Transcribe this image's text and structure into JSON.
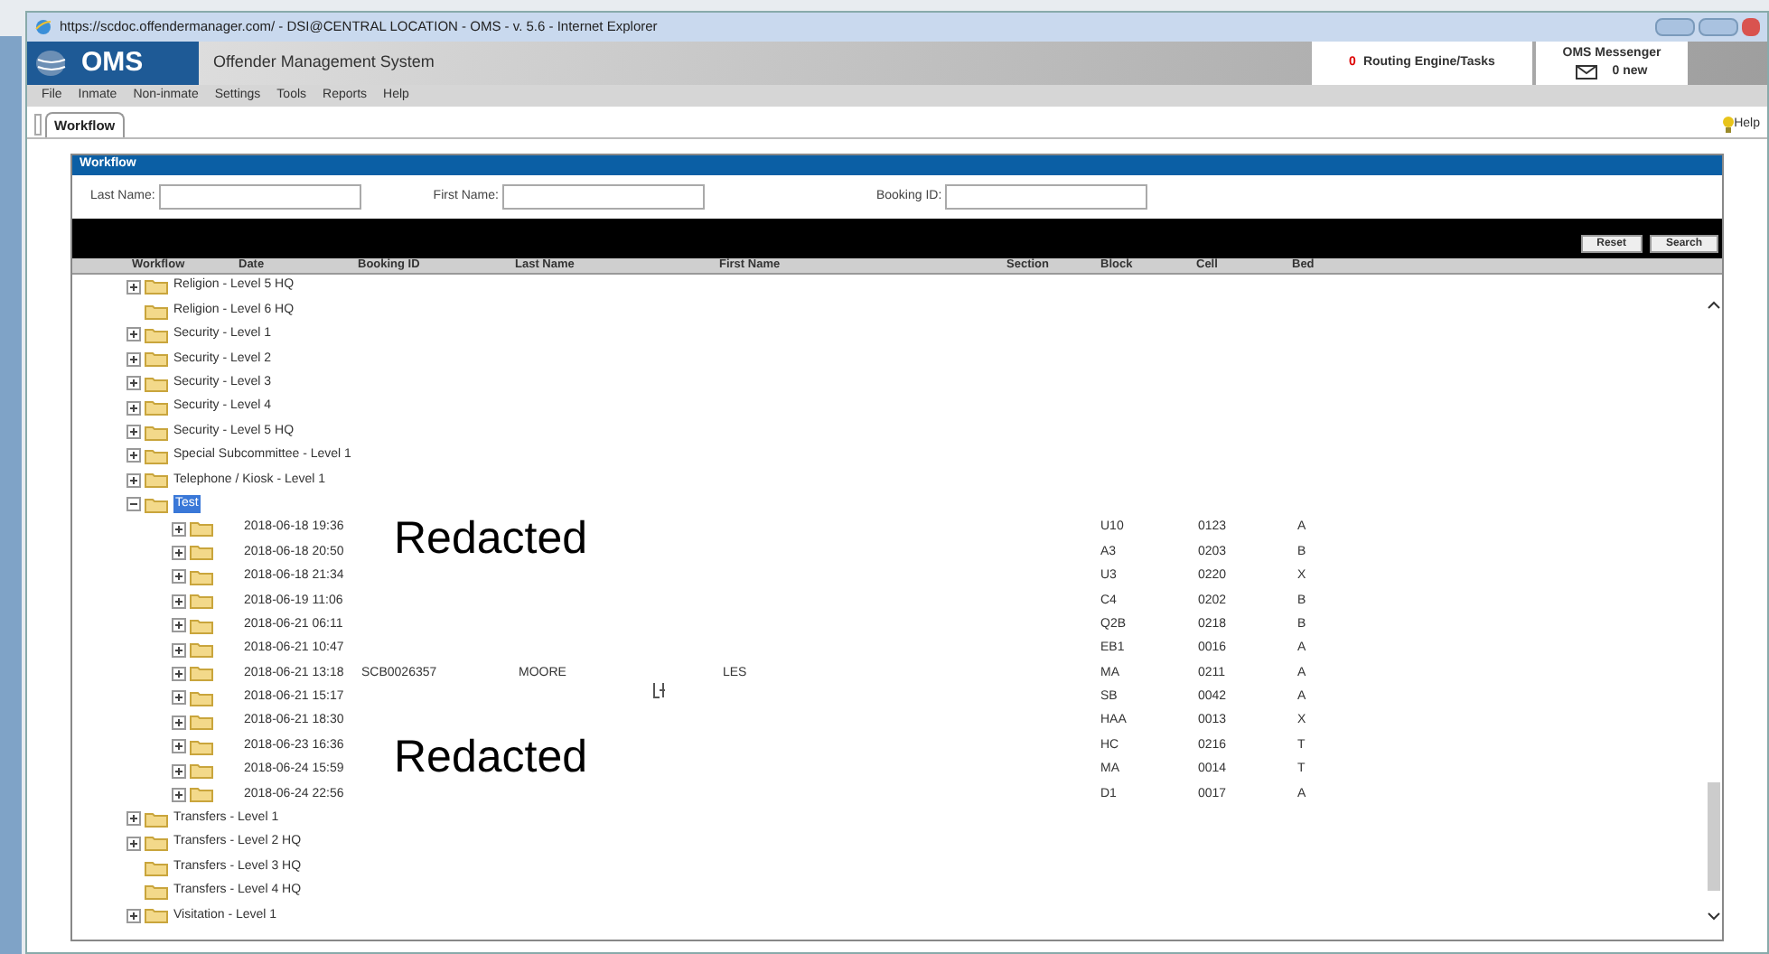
{
  "window": {
    "title": "https://scdoc.offendermanager.com/ - DSI@CENTRAL LOCATION - OMS - v. 5.6 - Internet Explorer"
  },
  "header": {
    "logo_text": "OMS",
    "app_name": "Offender Management System",
    "routing": {
      "count": "0",
      "label": "Routing Engine/Tasks"
    },
    "messenger": {
      "title": "OMS Messenger",
      "count": "0 new"
    }
  },
  "menu": [
    "File",
    "Inmate",
    "Non-inmate",
    "Settings",
    "Tools",
    "Reports",
    "Help"
  ],
  "tabs": [
    {
      "label": "Workflow",
      "selected": true
    }
  ],
  "help": "Help",
  "panel": {
    "title": "Workflow",
    "fields": [
      {
        "label": "Last Name:"
      },
      {
        "label": "First Name:"
      },
      {
        "label": "Booking ID:"
      }
    ],
    "buttons": [
      "Reset",
      "Search"
    ]
  },
  "table": {
    "columns": [
      "Workflow",
      "Date",
      "Booking ID",
      "Last Name",
      "First Name",
      "Section",
      "Block",
      "Cell",
      "Bed"
    ],
    "rows": [
      {
        "label": "Religion - Level 5 HQ",
        "expandable": true,
        "expanded": false,
        "selected": false
      },
      {
        "label": "Religion - Level 6 HQ",
        "expandable": false,
        "selected": false
      },
      {
        "label": "Security - Level 1",
        "expandable": true,
        "expanded": false,
        "selected": false
      },
      {
        "label": "Security - Level 2",
        "expandable": true,
        "expanded": false,
        "selected": false
      },
      {
        "label": "Security - Level 3",
        "expandable": true,
        "expanded": false,
        "selected": false
      },
      {
        "label": "Security - Level 4",
        "expandable": true,
        "expanded": false,
        "selected": false
      },
      {
        "label": "Security - Level 5 HQ",
        "expandable": true,
        "expanded": false,
        "selected": false
      },
      {
        "label": "Special Subcommittee - Level 1",
        "expandable": true,
        "expanded": false,
        "selected": false
      },
      {
        "label": "Telephone / Kiosk - Level 1",
        "expandable": true,
        "expanded": false,
        "selected": false
      },
      {
        "label": "Test",
        "expandable": true,
        "expanded": true,
        "selected": true,
        "children": [
          {
            "date": "2018-06-18 19:36",
            "block": "U10",
            "cell": "0123",
            "bed": "A"
          },
          {
            "date": "2018-06-18 20:50",
            "block": "A3",
            "cell": "0203",
            "bed": "B"
          },
          {
            "date": "2018-06-18 21:34",
            "block": "U3",
            "cell": "0220",
            "bed": "X"
          },
          {
            "date": "2018-06-19 11:06",
            "block": "C4",
            "cell": "0202",
            "bed": "B"
          },
          {
            "date": "2018-06-21 06:11",
            "block": "Q2B",
            "cell": "0218",
            "bed": "B"
          },
          {
            "date": "2018-06-21 10:47",
            "block": "EB1",
            "cell": "0016",
            "bed": "A"
          },
          {
            "date": "2018-06-21 13:18",
            "booking_id": "SCB0026357",
            "last_name": "MOORE",
            "first_name": "LES",
            "block": "MA",
            "cell": "0211",
            "bed": "A"
          },
          {
            "date": "2018-06-21 15:17",
            "block": "SB",
            "cell": "0042",
            "bed": "A"
          },
          {
            "date": "2018-06-21 18:30",
            "block": "HAA",
            "cell": "0013",
            "bed": "X"
          },
          {
            "date": "2018-06-23 16:36",
            "block": "HC",
            "cell": "0216",
            "bed": "T"
          },
          {
            "date": "2018-06-24 15:59",
            "block": "MA",
            "cell": "0014",
            "bed": "T"
          },
          {
            "date": "2018-06-24 22:56",
            "block": "D1",
            "cell": "0017",
            "bed": "A"
          }
        ]
      },
      {
        "label": "Transfers - Level 1",
        "expandable": true,
        "expanded": false,
        "selected": false
      },
      {
        "label": "Transfers - Level 2 HQ",
        "expandable": true,
        "expanded": false,
        "selected": false
      },
      {
        "label": "Transfers - Level 3 HQ",
        "expandable": false,
        "selected": false
      },
      {
        "label": "Transfers - Level 4 HQ",
        "expandable": false,
        "selected": false
      },
      {
        "label": "Visitation - Level 1",
        "expandable": true,
        "expanded": false,
        "selected": false
      }
    ]
  },
  "redactions": [
    "Redacted",
    "Redacted"
  ]
}
